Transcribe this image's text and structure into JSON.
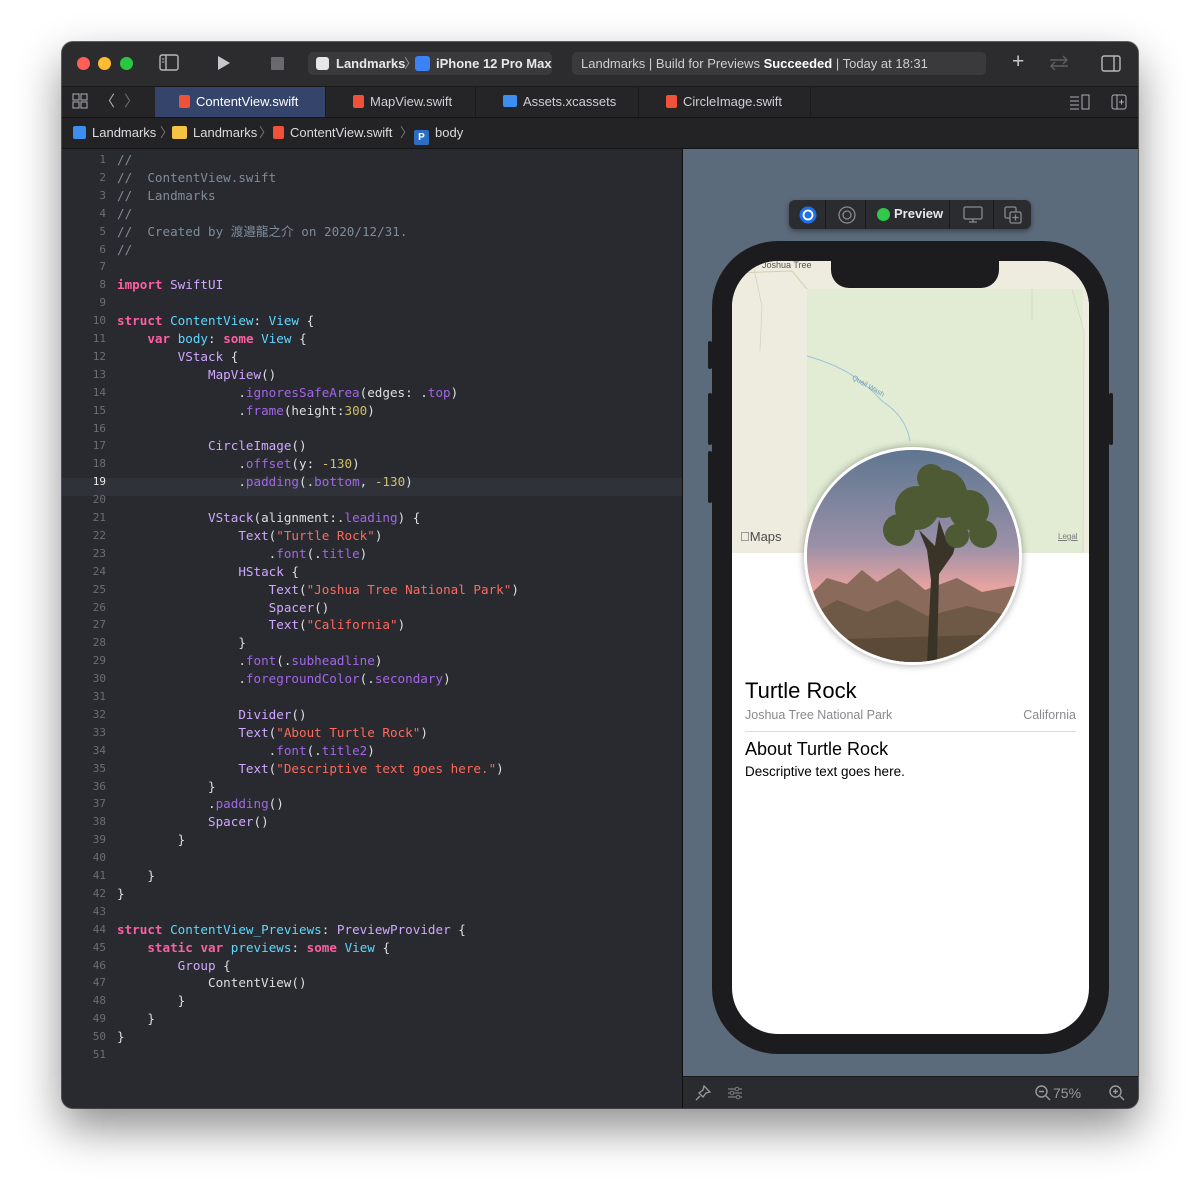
{
  "toolbar": {
    "scheme_target": "Landmarks",
    "scheme_device": "iPhone 12 Pro Max",
    "status_prefix": "Landmarks | Build for Previews ",
    "status_bold": "Succeeded",
    "status_suffix": " | Today at 18:31"
  },
  "tabs": [
    {
      "label": "ContentView.swift",
      "icon": "swift-file-icon",
      "active": true
    },
    {
      "label": "MapView.swift",
      "icon": "swift-file-icon",
      "active": false
    },
    {
      "label": "Assets.xcassets",
      "icon": "asset-catalog-icon",
      "active": false
    },
    {
      "label": "CircleImage.swift",
      "icon": "swift-file-icon",
      "active": false
    }
  ],
  "breadcrumb": {
    "project": "Landmarks",
    "folder": "Landmarks",
    "file": "ContentView.swift",
    "symbol_badge": "P",
    "symbol": "body"
  },
  "editor": {
    "current_line": 19,
    "lines": [
      "//",
      "//  ContentView.swift",
      "//  Landmarks",
      "//",
      "//  Created by 渡邉龍之介 on 2020/12/31.",
      "//",
      "",
      "import SwiftUI",
      "",
      "struct ContentView: View {",
      "    var body: some View {",
      "        VStack {",
      "            MapView()",
      "                .ignoresSafeArea(edges: .top)",
      "                .frame(height:300)",
      "",
      "            CircleImage()",
      "                .offset(y: -130)",
      "                .padding(.bottom, -130)",
      "",
      "            VStack(alignment:.leading) {",
      "                Text(\"Turtle Rock\")",
      "                    .font(.title)",
      "                HStack {",
      "                    Text(\"Joshua Tree National Park\")",
      "                    Spacer()",
      "                    Text(\"California\")",
      "                }",
      "                .font(.subheadline)",
      "                .foregroundColor(.secondary)",
      "",
      "                Divider()",
      "                Text(\"About Turtle Rock\")",
      "                    .font(.title2)",
      "                Text(\"Descriptive text goes here.\")",
      "            }",
      "            .padding()",
      "            Spacer()",
      "        }",
      "",
      "    }",
      "}",
      "",
      "struct ContentView_Previews: PreviewProvider {",
      "    static var previews: some View {",
      "        Group {",
      "            ContentView()",
      "        }",
      "    }",
      "}",
      ""
    ]
  },
  "preview": {
    "label": "Preview",
    "zoom": "75%",
    "map": {
      "place_label": "Joshua Tree",
      "wash_label": "Quail Wash",
      "maps_logo": "Maps",
      "legal": "Legal"
    },
    "content": {
      "title": "Turtle Rock",
      "park": "Joshua Tree National Park",
      "state": "California",
      "about_heading": "About Turtle Rock",
      "description": "Descriptive text goes here."
    }
  },
  "colors": {
    "keyword": "#fc5fa3",
    "type": "#5dd8ff",
    "other_decl": "#d0a8ff",
    "method": "#a167e6",
    "string": "#fc6a5d",
    "number": "#d0bf69",
    "comment": "#7f8c98",
    "active_tab": "#34446a",
    "canvas": "#5c6b7c"
  }
}
